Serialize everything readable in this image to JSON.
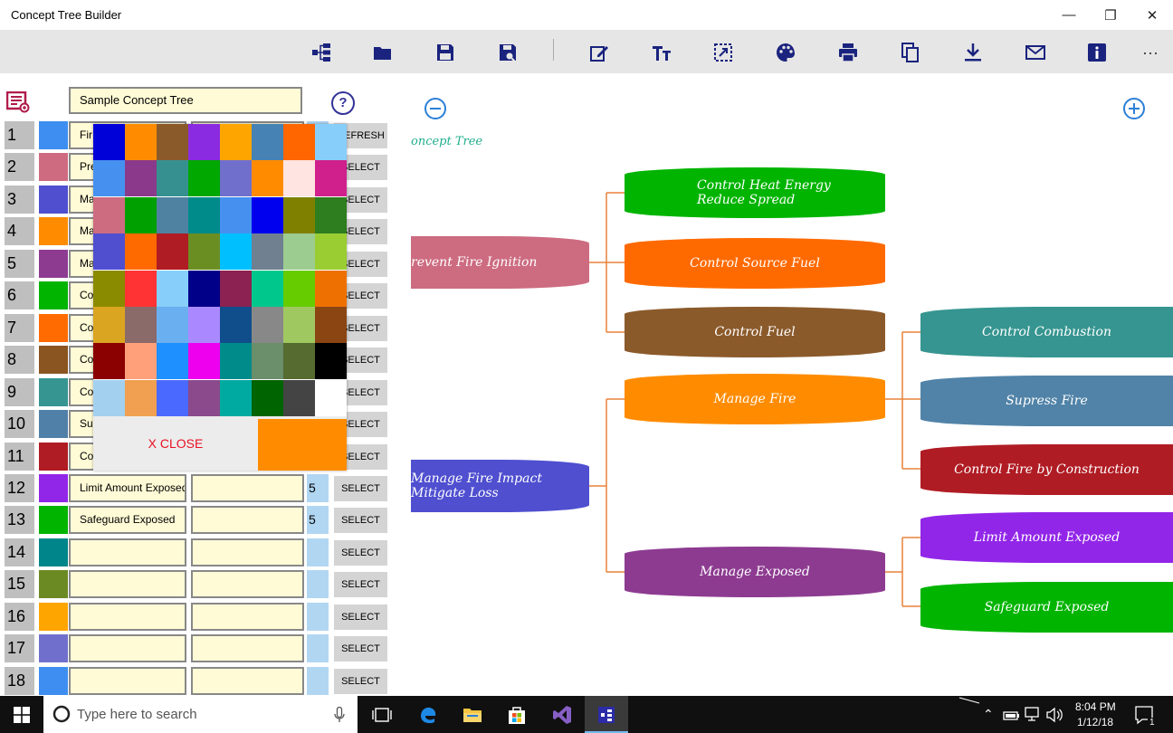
{
  "window": {
    "title": "Concept Tree Builder",
    "minimize": "—",
    "maximize": "❐",
    "close": "✕"
  },
  "toolbar": {
    "more": "···"
  },
  "editor": {
    "title_value": "Sample Concept Tree",
    "help": "?",
    "rows": [
      {
        "num": "1",
        "color": "#3d8ef0",
        "name": "Fir",
        "level": "",
        "select": "REFRESH"
      },
      {
        "num": "2",
        "color": "#cf6b80",
        "name": "Pre",
        "level": "",
        "select": "SELECT"
      },
      {
        "num": "3",
        "color": "#4f4fd0",
        "name": "Ma",
        "level": "",
        "select": "SELECT"
      },
      {
        "num": "4",
        "color": "#ff8c00",
        "name": "Ma",
        "level": "",
        "select": "SELECT"
      },
      {
        "num": "5",
        "color": "#8d3b91",
        "name": "Ma",
        "level": "",
        "select": "SELECT"
      },
      {
        "num": "6",
        "color": "#00b400",
        "name": "Co",
        "level": "",
        "select": "SELECT"
      },
      {
        "num": "7",
        "color": "#ff6b00",
        "name": "Co",
        "level": "",
        "select": "SELECT"
      },
      {
        "num": "8",
        "color": "#8a5520",
        "name": "Co",
        "level": "",
        "select": "SELECT"
      },
      {
        "num": "9",
        "color": "#369590",
        "name": "Co",
        "level": "",
        "select": "SELECT"
      },
      {
        "num": "10",
        "color": "#5080a8",
        "name": "Su",
        "level": "",
        "select": "SELECT"
      },
      {
        "num": "11",
        "color": "#b01c24",
        "name": "Co",
        "level": "",
        "select": "SELECT"
      },
      {
        "num": "12",
        "color": "#9226e8",
        "name": "Limit Amount Exposed",
        "level": "5",
        "select": "SELECT"
      },
      {
        "num": "13",
        "color": "#00b400",
        "name": "Safeguard Exposed",
        "level": "5",
        "select": "SELECT"
      },
      {
        "num": "14",
        "color": "#00868a",
        "name": "",
        "level": "",
        "select": "SELECT"
      },
      {
        "num": "15",
        "color": "#6b8a23",
        "name": "",
        "level": "",
        "select": "SELECT"
      },
      {
        "num": "16",
        "color": "#ffa500",
        "name": "",
        "level": "",
        "select": "SELECT"
      },
      {
        "num": "17",
        "color": "#7070cc",
        "name": "",
        "level": "",
        "select": "SELECT"
      },
      {
        "num": "18",
        "color": "#3d8ef0",
        "name": "",
        "level": "",
        "select": "SELECT"
      }
    ]
  },
  "color_picker": {
    "swatches": [
      "#0000d8",
      "#ff8c00",
      "#8b5a2b",
      "#8a2be2",
      "#ffa500",
      "#4682b4",
      "#ff6600",
      "#87cefa",
      "#4691f0",
      "#8b3a8b",
      "#379090",
      "#00a800",
      "#7070cc",
      "#ff8c00",
      "#ffe4e1",
      "#d0208c",
      "#cd6b80",
      "#00a000",
      "#4f82a0",
      "#008b8b",
      "#4691f0",
      "#0000ee",
      "#808000",
      "#2e7d1e",
      "#4f4fd0",
      "#ff6a00",
      "#b01c24",
      "#6b8e23",
      "#00bfff",
      "#708090",
      "#9ccc90",
      "#9acd32",
      "#8b8b00",
      "#ff3333",
      "#87cefa",
      "#000088",
      "#8b2252",
      "#00c88c",
      "#66cc00",
      "#ee7000",
      "#daa520",
      "#8b6a6a",
      "#6ab0f0",
      "#aa88ff",
      "#104e8b",
      "#888888",
      "#a0c860",
      "#8b4513",
      "#8b0000",
      "#ffa07a",
      "#1e90ff",
      "#ee00ee",
      "#008b8b",
      "#6b8e6b",
      "#556b2f",
      "#000000",
      "#a4d0f0",
      "#f0a050",
      "#4a6aff",
      "#8b4a8b",
      "#00aaa0",
      "#006400",
      "#444444",
      "#ffffff"
    ],
    "close_label": "X CLOSE",
    "selected_color": "#ff8c00"
  },
  "tree": {
    "title": "oncept Tree",
    "nodes": {
      "n_prevent": "revent Fire Ignition",
      "n_impact_1": "Manage Fire Impact",
      "n_impact_2": "Mitigate Loss",
      "n_heat_1": "Control Heat Energy",
      "n_heat_2": "Reduce Spread",
      "n_source": "Control Source Fuel",
      "n_fuel": "Control Fuel",
      "n_manage_fire": "Manage Fire",
      "n_manage_exposed": "Manage Exposed",
      "n_combustion": "Control Combustion",
      "n_supress": "Supress Fire",
      "n_construction": "Control Fire by Construction",
      "n_limit": "Limit Amount Exposed",
      "n_safeguard": "Safeguard Exposed"
    },
    "colors": {
      "prevent": "#cd6b80",
      "impact": "#4f4fd0",
      "heat": "#00b400",
      "source": "#ff6a00",
      "fuel": "#8b5a2b",
      "manage_fire": "#ff8c00",
      "manage_exposed": "#8d3b91",
      "combustion": "#369590",
      "supress": "#5183a8",
      "construction": "#b01c24",
      "limit": "#9226e8",
      "safeguard": "#00b400",
      "wire": "#e8823a"
    }
  },
  "taskbar": {
    "search_placeholder": "Type here to search",
    "time": "8:04 PM",
    "date": "1/12/18",
    "notif": "1"
  }
}
